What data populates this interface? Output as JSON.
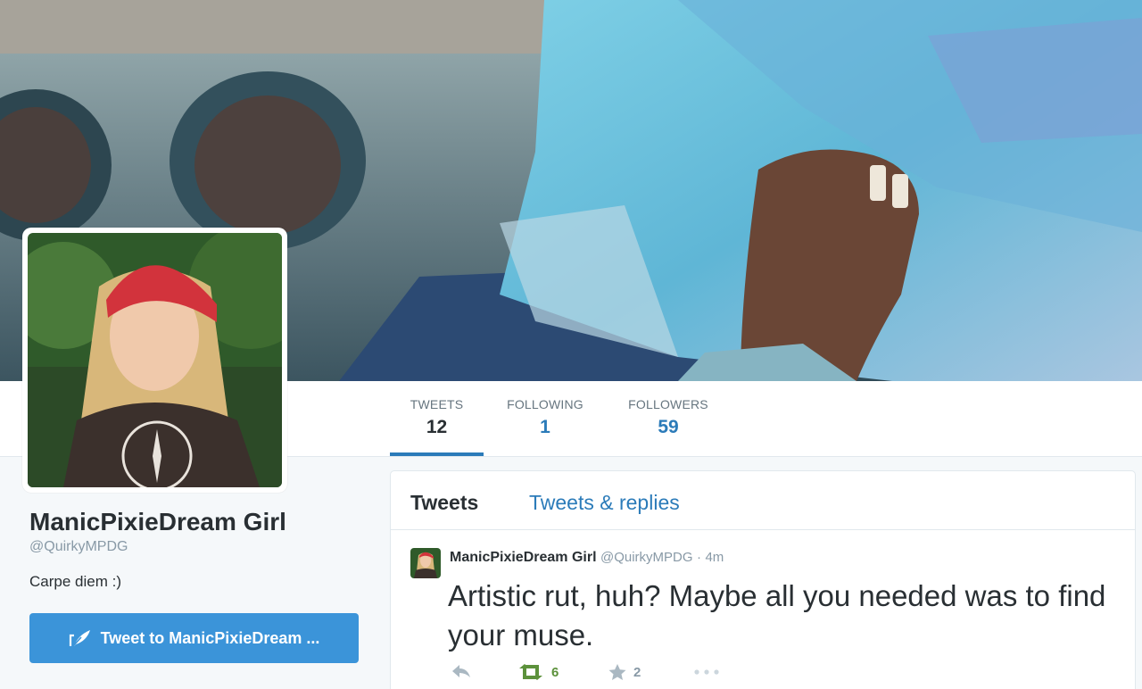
{
  "profile": {
    "full_name": "ManicPixieDream Girl",
    "screen_name": "@QuirkyMPDG",
    "bio": "Carpe diem :)",
    "tweet_to_label": "Tweet to ManicPixieDream ..."
  },
  "stats": {
    "tweets_label": "TWEETS",
    "tweets_count": "12",
    "following_label": "FOLLOWING",
    "following_count": "1",
    "followers_label": "FOLLOWERS",
    "followers_count": "59"
  },
  "timeline": {
    "tab_tweets": "Tweets",
    "tab_replies": "Tweets & replies",
    "tweet": {
      "name": "ManicPixieDream Girl",
      "handle": "@QuirkyMPDG",
      "separator": "·",
      "time": "4m",
      "text": "Artistic rut, huh? Maybe all you needed was to find your muse.",
      "retweets": "6",
      "favorites": "2"
    }
  },
  "icons": {
    "reply": "reply-icon",
    "retweet": "retweet-icon",
    "favorite": "star-icon",
    "more": "more-dots-icon",
    "compose": "quill-icon"
  },
  "colors": {
    "accent": "#2b7bb9",
    "button": "#3b94d9",
    "retweet_green": "#5c913b",
    "muted": "#8899a6"
  }
}
